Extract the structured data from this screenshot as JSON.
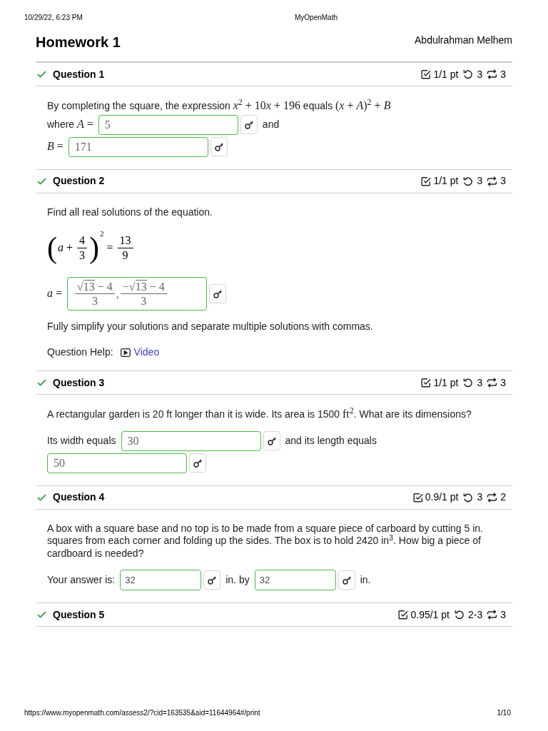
{
  "browser_header": {
    "datetime": "10/29/22, 6:23 PM",
    "site": "MyOpenMath"
  },
  "page": {
    "title": "Homework 1",
    "user": "Abdulrahman Melhem"
  },
  "questions": [
    {
      "correct": true,
      "title": "Question 1",
      "score": "1/1 pt",
      "tries": "3",
      "regens": "3",
      "body": [
        {
          "kind": "flow",
          "lines": [
            [
              {
                "kind": "label",
                "parts": [
                  {
                    "kind": "text",
                    "text": "By completing the square, the expression "
                  },
                  {
                    "kind": "math",
                    "text": "*x*$^{2}$ + 10"
                  },
                  {
                    "kind": "math",
                    "text": "*x* + 196"
                  },
                  {
                    "kind": "text",
                    "text": " equals "
                  },
                  {
                    "kind": "math",
                    "text": "(*x* + *A*)$^{2}$ + *B*"
                  }
                ]
              }
            ],
            [
              {
                "kind": "label",
                "parts": [
                  {
                    "kind": "text",
                    "text": "where "
                  },
                  {
                    "kind": "math",
                    "text": "*A* ="
                  }
                ]
              },
              {
                "kind": "math_answer",
                "correct": true,
                "value": [
                  {
                    "kind": "text",
                    "text": "5"
                  }
                ]
              },
              {
                "kind": "label",
                "parts": [
                  {
                    "kind": "text",
                    "text": "and"
                  }
                ]
              }
            ],
            [
              {
                "kind": "label",
                "parts": [
                  {
                    "kind": "math",
                    "text": "*B* ="
                  }
                ]
              },
              {
                "kind": "math_answer",
                "correct": true,
                "value": [
                  {
                    "kind": "text",
                    "text": "171"
                  }
                ]
              }
            ]
          ]
        }
      ]
    },
    {
      "correct": true,
      "title": "Question 2",
      "score": "1/1 pt",
      "tries": "3",
      "regens": "3",
      "body": [
        {
          "kind": "paragraph",
          "parts": [
            {
              "kind": "text",
              "text": "Find all real solutions of the equation."
            }
          ]
        },
        {
          "kind": "equation",
          "nodes": [
            {
              "kind": "paren",
              "open": "(",
              "close": ")",
              "power": "2",
              "body": [
                {
                  "kind": "text",
                  "text": "*a* + "
                },
                {
                  "kind": "frac",
                  "num": [
                    {
                      "kind": "text",
                      "text": "4"
                    }
                  ],
                  "den": [
                    {
                      "kind": "text",
                      "text": "3"
                    }
                  ]
                }
              ]
            },
            {
              "kind": "text",
              "text": " = "
            },
            {
              "kind": "frac",
              "num": [
                {
                  "kind": "text",
                  "text": "13"
                }
              ],
              "den": [
                {
                  "kind": "text",
                  "text": "9"
                }
              ]
            }
          ]
        },
        {
          "kind": "flow",
          "lines": [
            [
              {
                "kind": "label",
                "parts": [
                  {
                    "kind": "math",
                    "text": "*a* ="
                  }
                ]
              },
              {
                "kind": "math_answer",
                "correct": true,
                "value": [
                  {
                    "kind": "frac",
                    "num": [
                      {
                        "kind": "text",
                        "text": "√"
                      },
                      {
                        "kind": "overline",
                        "text": "13"
                      },
                      {
                        "kind": "text",
                        "text": " − 4"
                      }
                    ],
                    "den": [
                      {
                        "kind": "text",
                        "text": "3"
                      }
                    ]
                  },
                  {
                    "kind": "text",
                    "text": ","
                  },
                  {
                    "kind": "frac",
                    "num": [
                      {
                        "kind": "text",
                        "text": "−√"
                      },
                      {
                        "kind": "overline",
                        "text": "13"
                      },
                      {
                        "kind": "text",
                        "text": " − 4"
                      }
                    ],
                    "den": [
                      {
                        "kind": "text",
                        "text": "3"
                      }
                    ]
                  }
                ]
              }
            ]
          ]
        },
        {
          "kind": "paragraph",
          "parts": [
            {
              "kind": "text",
              "text": "Fully simplify your solutions and separate multiple solutions with commas."
            }
          ]
        },
        {
          "kind": "help",
          "label": "Question Help:",
          "links": [
            {
              "kind": "video",
              "text": "Video"
            }
          ]
        }
      ]
    },
    {
      "correct": true,
      "title": "Question 3",
      "score": "1/1 pt",
      "tries": "3",
      "regens": "3",
      "body": [
        {
          "kind": "paragraph",
          "parts": [
            {
              "kind": "text",
              "text": "A rectangular garden is 20 ft longer than it is wide. Its area is 1500 "
            },
            {
              "kind": "math",
              "text": "ft$^{2}$"
            },
            {
              "kind": "text",
              "text": ". What are its dimensions?"
            }
          ]
        },
        {
          "kind": "flow",
          "lines": [
            [
              {
                "kind": "label",
                "parts": [
                  {
                    "kind": "text",
                    "text": "Its width equals"
                  }
                ]
              },
              {
                "kind": "math_answer",
                "correct": true,
                "value": [
                  {
                    "kind": "text",
                    "text": "30"
                  }
                ]
              },
              {
                "kind": "label",
                "parts": [
                  {
                    "kind": "text",
                    "text": "and its length equals"
                  }
                ]
              }
            ],
            [
              {
                "kind": "math_answer",
                "correct": true,
                "value": [
                  {
                    "kind": "text",
                    "text": "50"
                  }
                ]
              }
            ]
          ]
        }
      ]
    },
    {
      "correct": true,
      "title": "Question 4",
      "score": "0.9/1 pt",
      "tries": "3",
      "regens": "2",
      "body": [
        {
          "kind": "paragraph",
          "parts": [
            {
              "kind": "text",
              "text": "A box with a square base and no top is to be made from a square piece of carboard by cutting 5 in. squares from each corner and folding up the sides. The box is to hold 2420 in$^{3}$. How big a piece of cardboard is needed?"
            }
          ]
        },
        {
          "kind": "flow",
          "lines": [
            [
              {
                "kind": "label",
                "parts": [
                  {
                    "kind": "text",
                    "text": "Your answer is:"
                  }
                ]
              },
              {
                "kind": "text_answer",
                "correct": true,
                "value": "32"
              },
              {
                "kind": "label",
                "parts": [
                  {
                    "kind": "text",
                    "text": "in. by"
                  }
                ]
              },
              {
                "kind": "text_answer",
                "correct": true,
                "value": "32"
              },
              {
                "kind": "label",
                "parts": [
                  {
                    "kind": "text",
                    "text": "in."
                  }
                ]
              }
            ]
          ]
        }
      ]
    },
    {
      "correct": true,
      "title": "Question 5",
      "score": "0.95/1 pt",
      "tries": "2-3",
      "regens": "3"
    }
  ],
  "browser_footer": {
    "url": "https://www.myopenmath.com/assess2/?cid=163535&aid=11644964#/print",
    "page": "1/10"
  }
}
